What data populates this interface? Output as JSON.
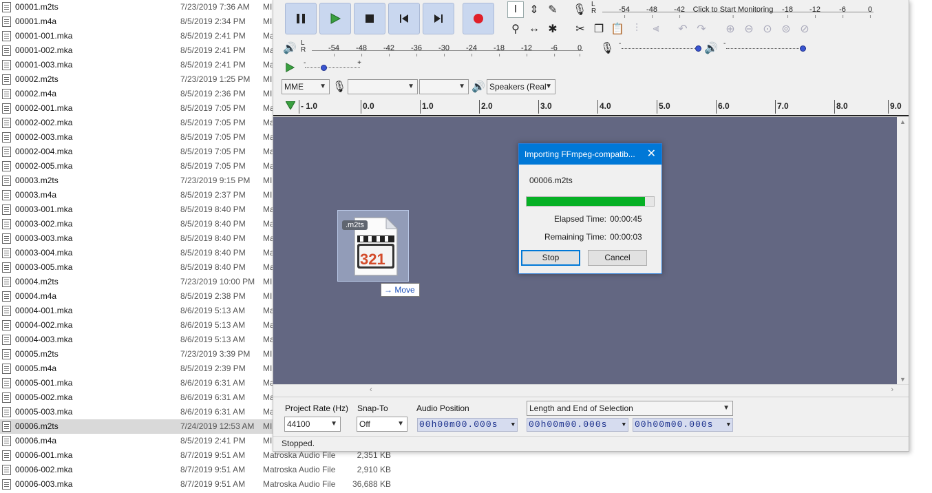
{
  "files": [
    {
      "name": "00001.m2ts",
      "date": "7/23/2019 7:36 AM",
      "type": "MI",
      "size": ""
    },
    {
      "name": "00001.m4a",
      "date": "8/5/2019 2:34 PM",
      "type": "MI",
      "size": ""
    },
    {
      "name": "00001-001.mka",
      "date": "8/5/2019 2:41 PM",
      "type": "Ma",
      "size": ""
    },
    {
      "name": "00001-002.mka",
      "date": "8/5/2019 2:41 PM",
      "type": "Ma",
      "size": ""
    },
    {
      "name": "00001-003.mka",
      "date": "8/5/2019 2:41 PM",
      "type": "Ma",
      "size": ""
    },
    {
      "name": "00002.m2ts",
      "date": "7/23/2019 1:25 PM",
      "type": "MI",
      "size": ""
    },
    {
      "name": "00002.m4a",
      "date": "8/5/2019 2:36 PM",
      "type": "MI",
      "size": ""
    },
    {
      "name": "00002-001.mka",
      "date": "8/5/2019 7:05 PM",
      "type": "Ma",
      "size": ""
    },
    {
      "name": "00002-002.mka",
      "date": "8/5/2019 7:05 PM",
      "type": "Ma",
      "size": ""
    },
    {
      "name": "00002-003.mka",
      "date": "8/5/2019 7:05 PM",
      "type": "Ma",
      "size": ""
    },
    {
      "name": "00002-004.mka",
      "date": "8/5/2019 7:05 PM",
      "type": "Ma",
      "size": ""
    },
    {
      "name": "00002-005.mka",
      "date": "8/5/2019 7:05 PM",
      "type": "Ma",
      "size": ""
    },
    {
      "name": "00003.m2ts",
      "date": "7/23/2019 9:15 PM",
      "type": "MI",
      "size": ""
    },
    {
      "name": "00003.m4a",
      "date": "8/5/2019 2:37 PM",
      "type": "MI",
      "size": ""
    },
    {
      "name": "00003-001.mka",
      "date": "8/5/2019 8:40 PM",
      "type": "Ma",
      "size": ""
    },
    {
      "name": "00003-002.mka",
      "date": "8/5/2019 8:40 PM",
      "type": "Ma",
      "size": ""
    },
    {
      "name": "00003-003.mka",
      "date": "8/5/2019 8:40 PM",
      "type": "Ma",
      "size": ""
    },
    {
      "name": "00003-004.mka",
      "date": "8/5/2019 8:40 PM",
      "type": "Ma",
      "size": ""
    },
    {
      "name": "00003-005.mka",
      "date": "8/5/2019 8:40 PM",
      "type": "Ma",
      "size": ""
    },
    {
      "name": "00004.m2ts",
      "date": "7/23/2019 10:00 PM",
      "type": "MI",
      "size": ""
    },
    {
      "name": "00004.m4a",
      "date": "8/5/2019 2:38 PM",
      "type": "MI",
      "size": ""
    },
    {
      "name": "00004-001.mka",
      "date": "8/6/2019 5:13 AM",
      "type": "Ma",
      "size": ""
    },
    {
      "name": "00004-002.mka",
      "date": "8/6/2019 5:13 AM",
      "type": "Ma",
      "size": ""
    },
    {
      "name": "00004-003.mka",
      "date": "8/6/2019 5:13 AM",
      "type": "Ma",
      "size": ""
    },
    {
      "name": "00005.m2ts",
      "date": "7/23/2019 3:39 PM",
      "type": "MI",
      "size": ""
    },
    {
      "name": "00005.m4a",
      "date": "8/5/2019 2:39 PM",
      "type": "MI",
      "size": ""
    },
    {
      "name": "00005-001.mka",
      "date": "8/6/2019 6:31 AM",
      "type": "Ma",
      "size": ""
    },
    {
      "name": "00005-002.mka",
      "date": "8/6/2019 6:31 AM",
      "type": "Ma",
      "size": ""
    },
    {
      "name": "00005-003.mka",
      "date": "8/6/2019 6:31 AM",
      "type": "Ma",
      "size": ""
    },
    {
      "name": "00006.m2ts",
      "date": "7/24/2019 12:53 AM",
      "type": "MI",
      "size": "",
      "selected": true
    },
    {
      "name": "00006.m4a",
      "date": "8/5/2019 2:41 PM",
      "type": "MI",
      "size": ""
    },
    {
      "name": "00006-001.mka",
      "date": "8/7/2019 9:51 AM",
      "type": "Matroska Audio File",
      "size": "2,351 KB"
    },
    {
      "name": "00006-002.mka",
      "date": "8/7/2019 9:51 AM",
      "type": "Matroska Audio File",
      "size": "2,910 KB"
    },
    {
      "name": "00006-003.mka",
      "date": "8/7/2019 9:51 AM",
      "type": "Matroska Audio File",
      "size": "36,688 KB"
    }
  ],
  "recording_meter": {
    "channels": "L\nR",
    "ticks": [
      "-54",
      "-48",
      "-42",
      "Click to Start Monitoring",
      "-18",
      "-12",
      "-6",
      "0"
    ]
  },
  "playback_meter": {
    "channels": "L\nR",
    "ticks": [
      "-54",
      "-48",
      "-42",
      "-36",
      "-30",
      "-24",
      "-18",
      "-12",
      "-6",
      "0"
    ]
  },
  "mixer": {
    "record_volume_level": 1.0,
    "playback_volume_level": 1.0,
    "minus": "-",
    "plus": "+"
  },
  "play_at_speed": {
    "minus": "-",
    "plus": "+",
    "level": 0.33
  },
  "device": {
    "host": "MME",
    "recording_device": "",
    "recording_channels": "",
    "playback_device": "Speakers (Real"
  },
  "ruler": {
    "ticks": [
      "- 1.0",
      "0.0",
      "1.0",
      "2.0",
      "3.0",
      "4.0",
      "5.0",
      "6.0",
      "7.0",
      "8.0",
      "9.0"
    ]
  },
  "drag": {
    "badge": ".m2ts",
    "icon_text": "321",
    "tooltip": "Move"
  },
  "dialog": {
    "title": "Importing FFmpeg-compatib...",
    "close": "✕",
    "filename": "00006.m2ts",
    "progress": 0.93,
    "elapsed_label": "Elapsed Time:",
    "elapsed_value": "00:00:45",
    "remaining_label": "Remaining Time:",
    "remaining_value": "00:00:03",
    "stop_label": "Stop",
    "cancel_label": "Cancel"
  },
  "selection_bar": {
    "project_rate_label": "Project Rate (Hz)",
    "project_rate_value": "44100",
    "snap_to_label": "Snap-To",
    "snap_to_value": "Off",
    "audio_position_label": "Audio Position",
    "audio_position_value": "00h00m00.000s",
    "selection_mode": "Length and End of Selection",
    "selection_start": "00h00m00.000s",
    "selection_end": "00h00m00.000s"
  },
  "status": "Stopped.",
  "colors": {
    "track_background": "#636782",
    "progress_fill": "#06b025",
    "dialog_titlebar": "#0078d7",
    "record_button": "#e0202a",
    "play_button": "#3aa040"
  }
}
